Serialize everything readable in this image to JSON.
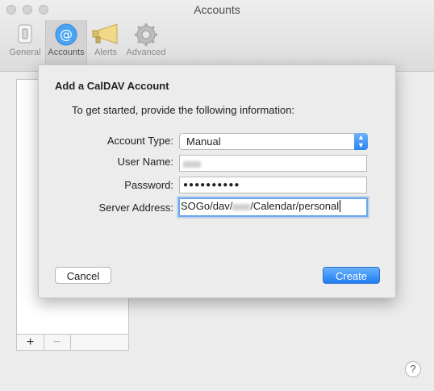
{
  "window": {
    "title": "Accounts"
  },
  "toolbar": {
    "items": [
      {
        "label": "General"
      },
      {
        "label": "Accounts"
      },
      {
        "label": "Alerts"
      },
      {
        "label": "Advanced"
      }
    ]
  },
  "sidebar": {
    "add_label": "+",
    "remove_label": "−"
  },
  "sheet": {
    "title": "Add a CalDAV Account",
    "subtitle": "To get started, provide the following information:",
    "account_type": {
      "label": "Account Type:",
      "value": "Manual"
    },
    "user_name": {
      "label": "User Name:"
    },
    "password": {
      "label": "Password:",
      "value": "●●●●●●●●●●"
    },
    "server_address": {
      "label": "Server Address:",
      "prefix": "SOGo/dav/",
      "suffix": "/Calendar/personal"
    },
    "cancel_label": "Cancel",
    "create_label": "Create"
  },
  "help_label": "?"
}
